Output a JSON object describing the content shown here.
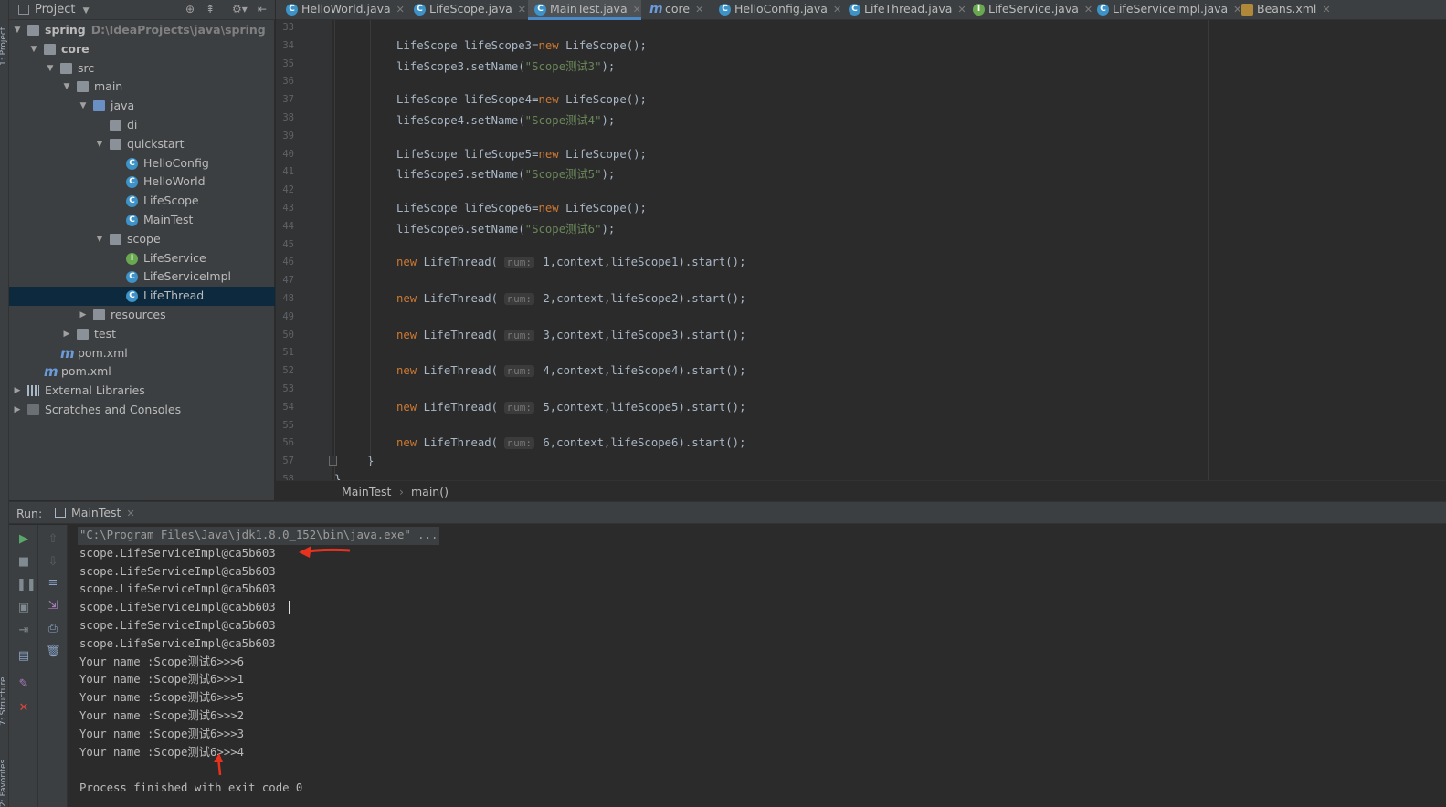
{
  "sidebar_tabs": {
    "project": "1: Project",
    "structure": "7: Structure",
    "favorites": "2: Favorites"
  },
  "project": {
    "title": "Project",
    "tree": [
      {
        "label": "spring",
        "sub": "D:\\IdeaProjects\\java\\spring",
        "icon": "module-folder-icon",
        "depth": 0,
        "expanded": true
      },
      {
        "label": "core",
        "icon": "module-folder-icon",
        "depth": 1,
        "expanded": true
      },
      {
        "label": "src",
        "icon": "folder-icon",
        "depth": 2,
        "expanded": true
      },
      {
        "label": "main",
        "icon": "folder-icon",
        "depth": 3,
        "expanded": true
      },
      {
        "label": "java",
        "icon": "source-folder-icon",
        "depth": 4,
        "expanded": true
      },
      {
        "label": "di",
        "icon": "package-icon",
        "depth": 5
      },
      {
        "label": "quickstart",
        "icon": "package-icon",
        "depth": 5,
        "expanded": true
      },
      {
        "label": "HelloConfig",
        "icon": "class-icon",
        "depth": 6
      },
      {
        "label": "HelloWorld",
        "icon": "class-icon",
        "depth": 6
      },
      {
        "label": "LifeScope",
        "icon": "class-icon",
        "depth": 6
      },
      {
        "label": "MainTest",
        "icon": "class-icon",
        "depth": 6
      },
      {
        "label": "scope",
        "icon": "package-icon",
        "depth": 5,
        "expanded": true
      },
      {
        "label": "LifeService",
        "icon": "interface-icon",
        "depth": 6
      },
      {
        "label": "LifeServiceImpl",
        "icon": "class-icon",
        "depth": 6
      },
      {
        "label": "LifeThread",
        "icon": "class-icon",
        "depth": 6,
        "selected": true
      },
      {
        "label": "resources",
        "icon": "resources-folder-icon",
        "depth": 4,
        "expanded": false
      },
      {
        "label": "test",
        "icon": "folder-icon",
        "depth": 3,
        "expanded": false
      },
      {
        "label": "pom.xml",
        "icon": "maven-icon",
        "depth": 2
      },
      {
        "label": "pom.xml",
        "icon": "maven-icon",
        "depth": 1
      },
      {
        "label": "External Libraries",
        "icon": "library-icon",
        "depth": 0,
        "expanded": false
      },
      {
        "label": "Scratches and Consoles",
        "icon": "scratches-icon",
        "depth": 0,
        "expanded": false
      }
    ]
  },
  "tabs": [
    {
      "label": "HelloWorld.java",
      "icon": "C"
    },
    {
      "label": "LifeScope.java",
      "icon": "C"
    },
    {
      "label": "MainTest.java",
      "icon": "C",
      "active": true
    },
    {
      "label": "core",
      "icon": "m"
    },
    {
      "label": "HelloConfig.java",
      "icon": "C"
    },
    {
      "label": "LifeThread.java",
      "icon": "C"
    },
    {
      "label": "LifeService.java",
      "icon": "I"
    },
    {
      "label": "LifeServiceImpl.java",
      "icon": "C"
    },
    {
      "label": "Beans.xml",
      "icon": "x"
    }
  ],
  "editor": {
    "lines": [
      {
        "n": "33",
        "t": ""
      },
      {
        "n": "34",
        "t": "LifeScope lifeScope3=new LifeScope();"
      },
      {
        "n": "35",
        "t": "lifeScope3.setName(\"Scope测试3\");"
      },
      {
        "n": "36",
        "t": ""
      },
      {
        "n": "37",
        "t": "LifeScope lifeScope4=new LifeScope();"
      },
      {
        "n": "38",
        "t": "lifeScope4.setName(\"Scope测试4\");"
      },
      {
        "n": "39",
        "t": ""
      },
      {
        "n": "40",
        "t": "LifeScope lifeScope5=new LifeScope();"
      },
      {
        "n": "41",
        "t": "lifeScope5.setName(\"Scope测试5\");"
      },
      {
        "n": "42",
        "t": ""
      },
      {
        "n": "43",
        "t": "LifeScope lifeScope6=new LifeScope();"
      },
      {
        "n": "44",
        "t": "lifeScope6.setName(\"Scope测试6\");"
      },
      {
        "n": "45",
        "t": ""
      },
      {
        "n": "46",
        "t": "new LifeThread( num: 1,context,lifeScope1).start();"
      },
      {
        "n": "47",
        "t": ""
      },
      {
        "n": "48",
        "t": "new LifeThread( num: 2,context,lifeScope2).start();"
      },
      {
        "n": "49",
        "t": ""
      },
      {
        "n": "50",
        "t": "new LifeThread( num: 3,context,lifeScope3).start();"
      },
      {
        "n": "51",
        "t": ""
      },
      {
        "n": "52",
        "t": "new LifeThread( num: 4,context,lifeScope4).start();"
      },
      {
        "n": "53",
        "t": ""
      },
      {
        "n": "54",
        "t": "new LifeThread( num: 5,context,lifeScope5).start();"
      },
      {
        "n": "55",
        "t": ""
      },
      {
        "n": "56",
        "t": "new LifeThread( num: 6,context,lifeScope6).start();"
      },
      {
        "n": "57",
        "t": "}"
      },
      {
        "n": "58",
        "t": "}"
      }
    ]
  },
  "breadcrumb": {
    "class": "MainTest",
    "method": "main()"
  },
  "run": {
    "label": "Run:",
    "tab": "MainTest",
    "output": [
      "\"C:\\Program Files\\Java\\jdk1.8.0_152\\bin\\java.exe\" ...",
      "scope.LifeServiceImpl@ca5b603",
      "scope.LifeServiceImpl@ca5b603",
      "scope.LifeServiceImpl@ca5b603",
      "scope.LifeServiceImpl@ca5b603",
      "scope.LifeServiceImpl@ca5b603",
      "scope.LifeServiceImpl@ca5b603",
      "Your name :Scope测试6>>>6",
      "Your name :Scope测试6>>>1",
      "Your name :Scope测试6>>>5",
      "Your name :Scope测试6>>>2",
      "Your name :Scope测试6>>>3",
      "Your name :Scope测试6>>>4",
      "",
      "Process finished with exit code 0"
    ]
  },
  "colors": {
    "accent": "#4a88c7",
    "keyword": "#cc7832",
    "string": "#6a8759",
    "annotation_arrow": "#e8321e"
  }
}
